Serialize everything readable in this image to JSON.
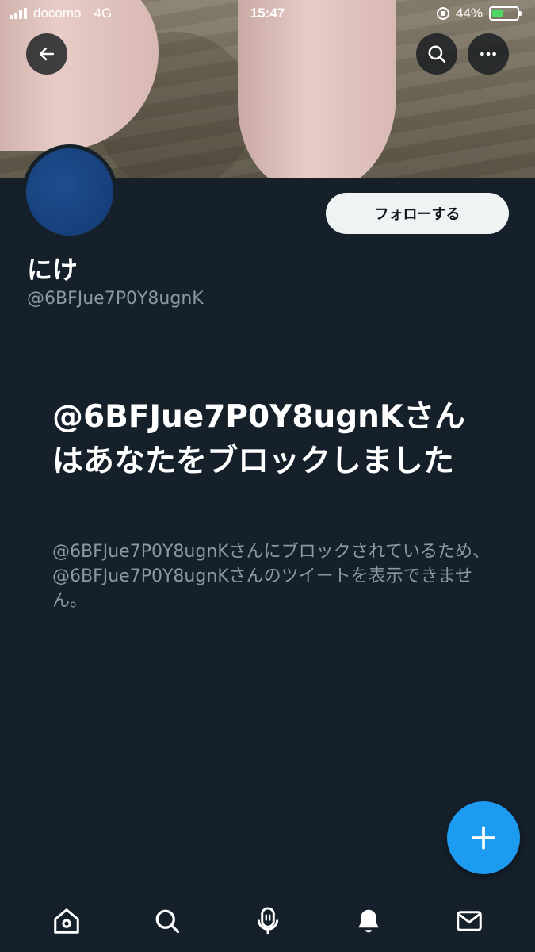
{
  "status_bar": {
    "carrier": "docomo",
    "network": "4G",
    "time": "15:47",
    "battery_percent": "44%",
    "battery_level": 0.44
  },
  "header": {
    "back_icon": "arrow-left-icon",
    "search_icon": "search-icon",
    "more_icon": "more-horizontal-icon"
  },
  "profile": {
    "follow_label": "フォローする",
    "display_name": "にけ",
    "handle": "@6BFJue7P0Y8ugnK"
  },
  "blocked": {
    "title": "@6BFJue7P0Y8ugnKさんはあなたをブロックしました",
    "description": "@6BFJue7P0Y8ugnKさんにブロックされているため、@6BFJue7P0Y8ugnKさんのツイートを表示できません。"
  },
  "fab": {
    "icon": "plus-icon"
  },
  "tab_bar": {
    "items": [
      "home-icon",
      "search-icon",
      "spaces-icon",
      "notifications-icon",
      "messages-icon"
    ]
  },
  "colors": {
    "background": "#15202b",
    "accent": "#1d9bf0",
    "secondary_text": "#8b98a5",
    "follow_button": "#eff3f4"
  }
}
